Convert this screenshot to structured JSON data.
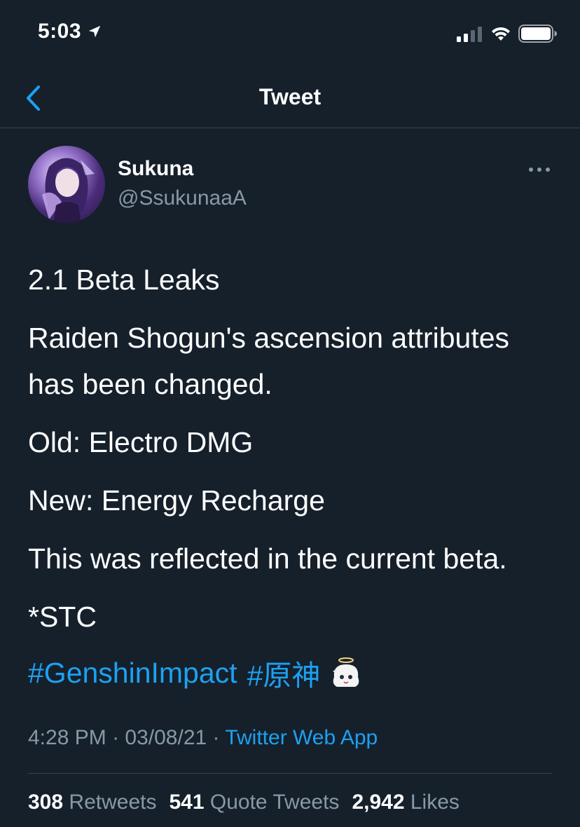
{
  "status_bar": {
    "time": "5:03"
  },
  "nav": {
    "title": "Tweet"
  },
  "author": {
    "display_name": "Sukuna",
    "handle": "@SsukunaaA"
  },
  "tweet": {
    "paragraphs": [
      "2.1 Beta Leaks",
      "Raiden Shogun's ascension attributes has been changed.",
      "Old: Electro DMG",
      "New: Energy Recharge",
      "This was reflected in the current beta.",
      "*STC"
    ],
    "hashtags": [
      "#GenshinImpact",
      "#原神"
    ],
    "time": "4:28 PM",
    "date": "03/08/21",
    "separator": "·",
    "source": "Twitter Web App"
  },
  "stats": {
    "retweets_count": "308",
    "retweets_label": "Retweets",
    "quotes_count": "541",
    "quotes_label": "Quote Tweets",
    "likes_count": "2,942",
    "likes_label": "Likes"
  },
  "colors": {
    "background": "#15202b",
    "accent": "#1da1f2",
    "secondary_text": "#8899a6",
    "divider": "#38444d"
  },
  "icons": {
    "location": "location-arrow-icon",
    "signal": "cellular-signal-icon",
    "wifi": "wifi-icon",
    "battery": "battery-icon",
    "back": "chevron-left-icon",
    "more": "more-horizontal-icon",
    "emoji": "paimon-emoji-icon"
  }
}
